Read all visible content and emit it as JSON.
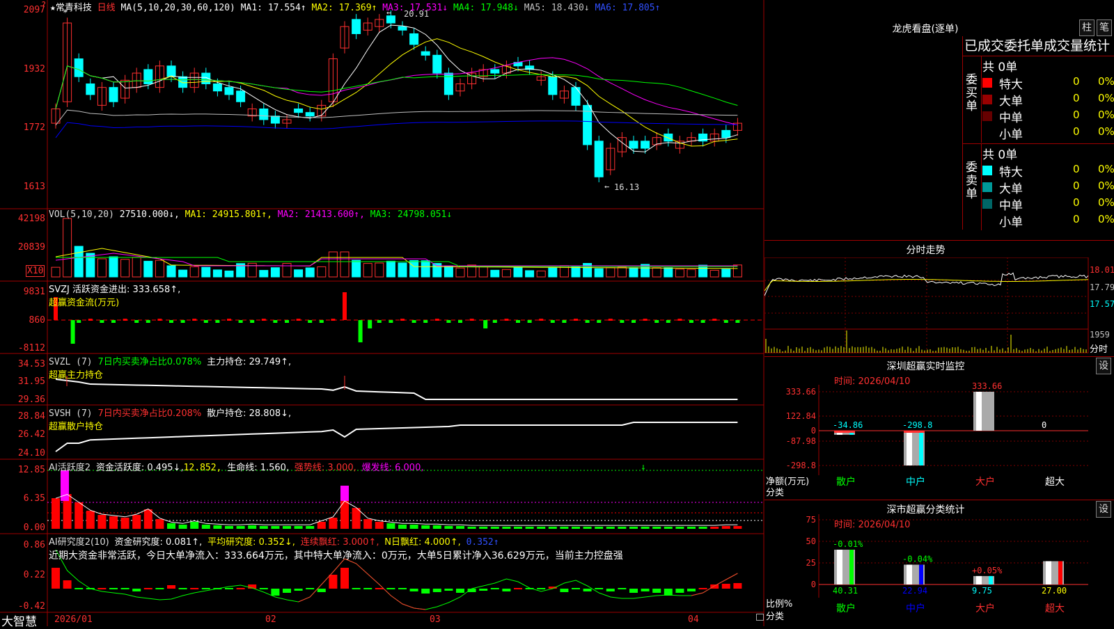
{
  "colors": {
    "up": "#ff3030",
    "down": "#00ffff",
    "grid": "#800000",
    "ma1": "#ffffff",
    "ma2": "#ffff00",
    "ma3": "#ff00ff",
    "ma4": "#00ff00",
    "ma5": "#c0c0c0",
    "ma6": "#0000ff",
    "accent_red": "#ff0000"
  },
  "header": {
    "star": "★",
    "name": "常青科技",
    "period": "日线",
    "ma_label": "MA(5,10,20,30,60,120)",
    "ma1": "MA1: 17.554↑",
    "ma2": "MA2: 17.369↑",
    "ma3": "MA3: 17.531↓",
    "ma4": "MA4: 17.948↓",
    "ma5": "MA5: 18.430↓",
    "ma6": "MA6: 17.805↑"
  },
  "price_panel": {
    "ticks": [
      "2097",
      "1932",
      "1772",
      "1613"
    ],
    "high_label": "20.91",
    "low_label": "16.13",
    "corner_mark": "?"
  },
  "vol_panel": {
    "title": "VOL(5,10,20)",
    "vol": "27510.000↓,",
    "ma1": "MA1: 24915.801↑,",
    "ma2": "MA2: 21413.600↑,",
    "ma3": "MA3: 24798.051↓",
    "ticks": [
      "42198",
      "20839"
    ],
    "unit": "X10"
  },
  "svzj_panel": {
    "title": "SVZJ  活跃资金进出: 333.658↑,",
    "subtitle": "超赢资金流(万元)",
    "ticks": [
      "9831",
      "860",
      "-8112"
    ]
  },
  "svzl_panel": {
    "prefix": "SVZL (7)",
    "ratio": "7日内买卖净占比0.078%",
    "hold": "主力持仓: 29.749↑,",
    "subtitle": "超赢主力持仓",
    "ticks": [
      "34.53",
      "31.95",
      "29.36"
    ]
  },
  "svsh_panel": {
    "prefix": "SVSH (7)",
    "ratio": "7日内买卖净占比0.208%",
    "hold": "散户持仓: 28.808↓,",
    "subtitle": "超赢散户持仓",
    "ticks": [
      "28.84",
      "26.42",
      "24.10"
    ]
  },
  "ai_active": {
    "title": "AI活跃度2",
    "a": "资金活跃度: 0.495↓,",
    "b": "12.852,",
    "c": "生命线: 1.560,",
    "d": "强势线: 3.000,",
    "e": "爆发线: 6.000,",
    "ticks": [
      "12.85",
      "6.35",
      "0.00"
    ]
  },
  "ai_research": {
    "title": "AI研究度2(10)",
    "a": "资金研究度: 0.081↑,",
    "b": "平均研究度: 0.352↓,",
    "c": "连续飘红: 3.000↑,",
    "d": "N日飘红: 4.000↑,",
    "e": "0.352↑",
    "summary": "近期大资金非常活跃，今日大单净流入：333.664万元，其中特大单净流入：0万元，大单5日累计净入36.629万元，当前主力控盘强",
    "ticks": [
      "0.86",
      "0.22",
      "-0.42"
    ]
  },
  "xaxis": {
    "brand": "大智慧",
    "dates": [
      "2026/01",
      "02",
      "03",
      "04"
    ]
  },
  "right": {
    "dragon_title": "龙虎看盘(逐单)",
    "btn_zhu": "柱",
    "btn_bi": "笔",
    "table_title": "已成交委托单成交量统计",
    "buy_label": "委买单",
    "sell_label": "委卖单",
    "buy_total": "共 0单",
    "sell_total": "共 0单",
    "buy_rows": [
      {
        "name": "特大",
        "val": "0",
        "pct": "0%",
        "color": "#ff0000"
      },
      {
        "name": "大单",
        "val": "0",
        "pct": "0%",
        "color": "#990000"
      },
      {
        "name": "中单",
        "val": "0",
        "pct": "0%",
        "color": "#660000"
      },
      {
        "name": "小单",
        "val": "0",
        "pct": "0%",
        "color": ""
      }
    ],
    "sell_rows": [
      {
        "name": "特大",
        "val": "0",
        "pct": "0%",
        "color": "#00ffff"
      },
      {
        "name": "大单",
        "val": "0",
        "pct": "0%",
        "color": "#009999"
      },
      {
        "name": "中单",
        "val": "0",
        "pct": "0%",
        "color": "#006666"
      },
      {
        "name": "小单",
        "val": "0",
        "pct": "0%",
        "color": ""
      }
    ],
    "intraday_title": "分时走势",
    "intraday_ticks": [
      "18.01",
      "17.79",
      "17.57",
      "1959",
      "分时"
    ],
    "sz_title": "深圳超赢实时监控",
    "sz_time": "时间: 2026/04/10",
    "sz_btn": "设",
    "sz_ticks": [
      "333.66",
      "122.84",
      "0",
      "-87.98",
      "-298.8"
    ],
    "sz_axis_label": "净额(万元)",
    "sz_category_label": "分类",
    "sz_bars": [
      {
        "label": "散户",
        "value": "-34.86",
        "num": -34.86
      },
      {
        "label": "中户",
        "value": "-298.8",
        "num": -298.8
      },
      {
        "label": "大户",
        "value": "333.66",
        "num": 333.66
      },
      {
        "label": "超大",
        "value": "0",
        "num": 0
      }
    ],
    "cls_title": "深市超赢分类统计",
    "cls_time": "时间: 2026/04/10",
    "cls_btn": "设",
    "cls_ticks": [
      "75",
      "50",
      "25",
      "0"
    ],
    "cls_axis_label": "比例%",
    "cls_category_label": "分类",
    "cls_bars": [
      {
        "label": "散户",
        "value": "40.31",
        "chg": "-0.01%",
        "num": 40.31
      },
      {
        "label": "中户",
        "value": "22.94",
        "chg": "-0.04%",
        "num": 22.94
      },
      {
        "label": "大户",
        "value": "9.75",
        "chg": "+0.05%",
        "num": 9.75
      },
      {
        "label": "超大",
        "value": "27.00",
        "chg": "",
        "num": 27.0
      }
    ]
  }
}
